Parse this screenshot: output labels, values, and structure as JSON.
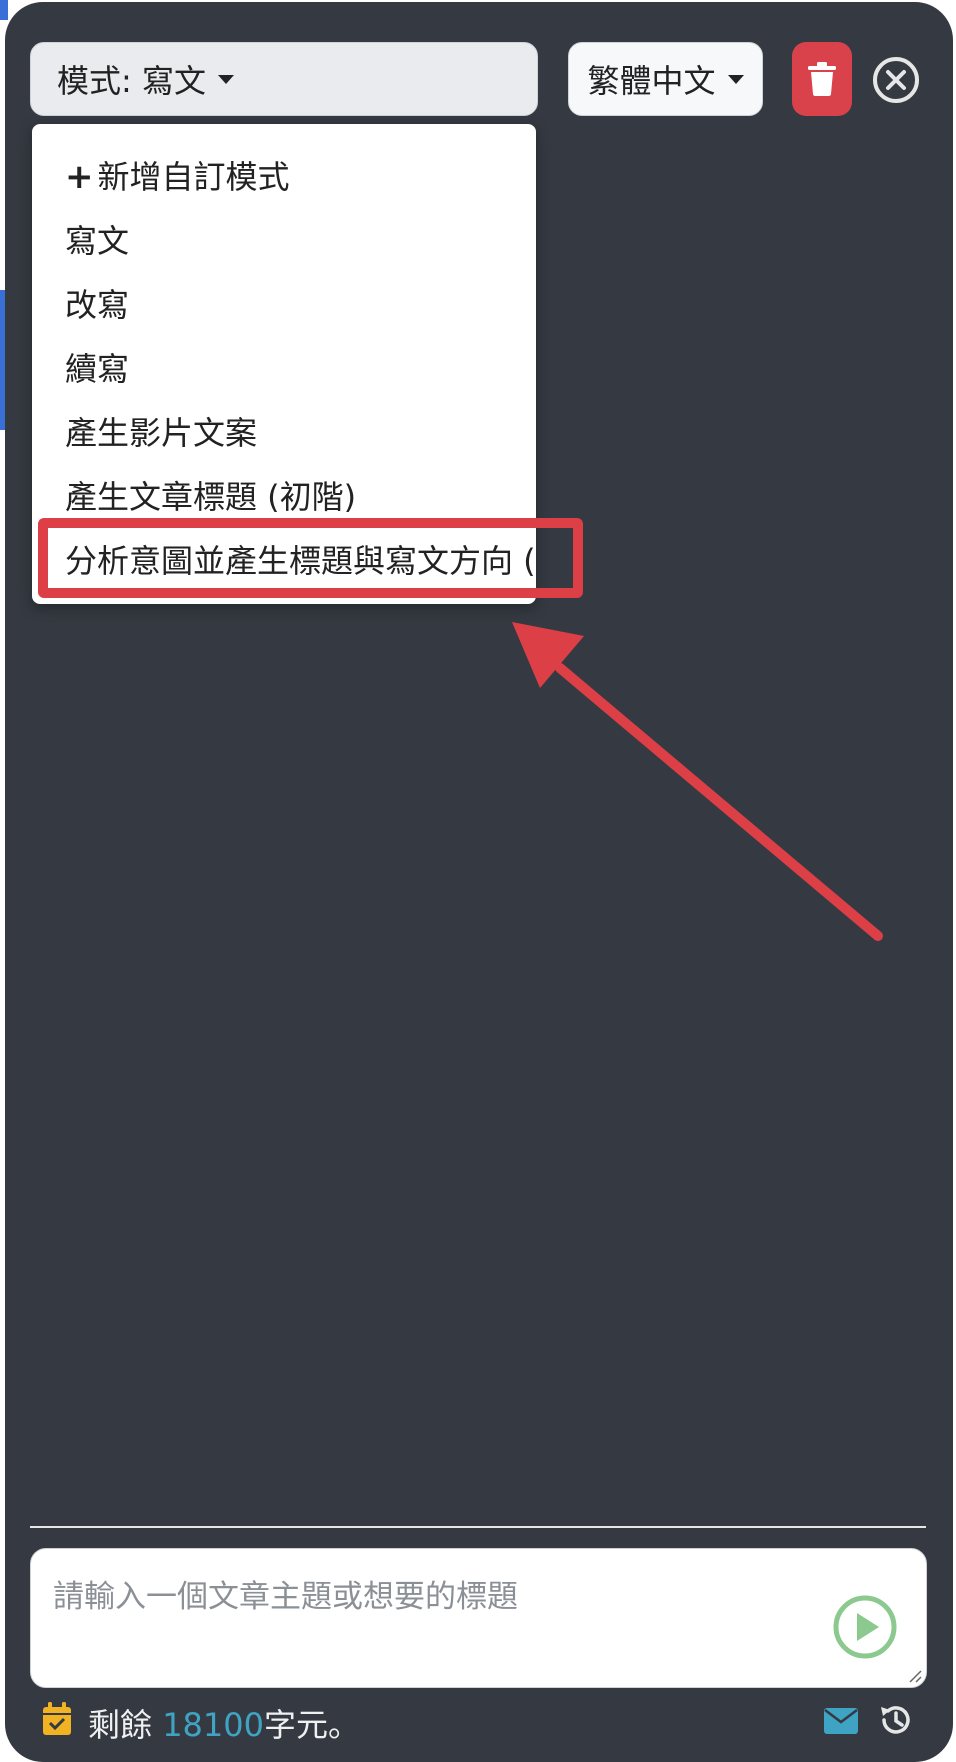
{
  "toolbar": {
    "mode_label": "模式: 寫文",
    "language_label": "繁體中文"
  },
  "mode_menu": {
    "items": [
      {
        "label": "新增自訂模式",
        "icon": "plus-icon"
      },
      {
        "label": "寫文"
      },
      {
        "label": "改寫"
      },
      {
        "label": "續寫"
      },
      {
        "label": "產生影片文案"
      },
      {
        "label": "產生文章標題 (初階)"
      },
      {
        "label": "分析意圖並產生標題與寫文方向 (新"
      }
    ],
    "highlighted_index": 6
  },
  "composer": {
    "placeholder": "請輸入一個文章主題或想要的標題"
  },
  "footer": {
    "prefix": "剩餘",
    "count": "18100",
    "suffix": "字元。"
  },
  "colors": {
    "panel": "#353a42",
    "delete": "#d9424a",
    "annotation": "#dd3f47",
    "send": "#8cc98e",
    "count": "#3fa3c4",
    "calendar": "#f1b323",
    "mail": "#3fa3c4"
  }
}
